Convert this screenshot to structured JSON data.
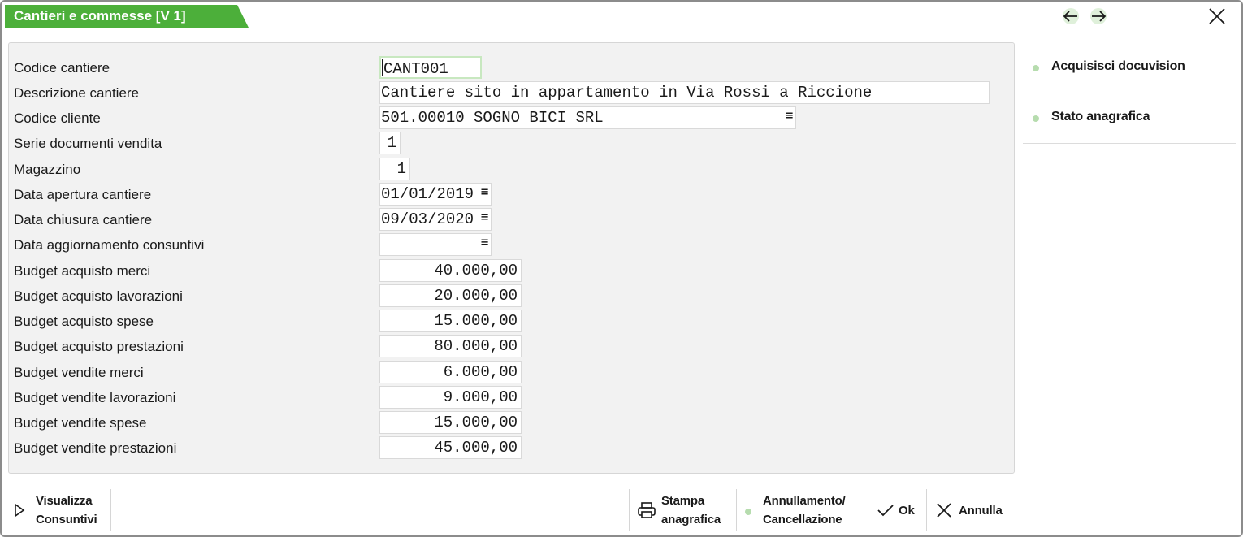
{
  "window": {
    "title": "Cantieri e commesse [V 1]",
    "accent_color": "#4caf3a",
    "icons": {
      "back": "arrow-left-icon",
      "forward": "arrow-right-icon",
      "close": "close-icon"
    }
  },
  "form": {
    "fields": [
      {
        "key": "codice_cantiere",
        "label": "Codice cantiere",
        "value": "CANT001"
      },
      {
        "key": "descrizione_cantiere",
        "label": "Descrizione cantiere",
        "value": "Cantiere sito in appartamento in Via Rossi a Riccione"
      },
      {
        "key": "codice_cliente",
        "label": "Codice cliente",
        "value": "501.00010 SOGNO BICI SRL"
      },
      {
        "key": "serie_documenti",
        "label": "Serie documenti vendita",
        "value": "1"
      },
      {
        "key": "magazzino",
        "label": "Magazzino",
        "value": "1"
      },
      {
        "key": "data_apertura",
        "label": "Data apertura cantiere",
        "value": "01/01/2019"
      },
      {
        "key": "data_chiusura",
        "label": "Data chiusura cantiere",
        "value": "09/03/2020"
      },
      {
        "key": "data_aggiornamento",
        "label": "Data aggiornamento consuntivi",
        "value": ""
      },
      {
        "key": "budget_acq_merci",
        "label": "Budget acquisto merci",
        "value": "40.000,00"
      },
      {
        "key": "budget_acq_lavorazioni",
        "label": "Budget acquisto lavorazioni",
        "value": "20.000,00"
      },
      {
        "key": "budget_acq_spese",
        "label": "Budget acquisto spese",
        "value": "15.000,00"
      },
      {
        "key": "budget_acq_prestazioni",
        "label": "Budget acquisto prestazioni",
        "value": "80.000,00"
      },
      {
        "key": "budget_ven_merci",
        "label": "Budget vendite merci",
        "value": "6.000,00"
      },
      {
        "key": "budget_ven_lavorazioni",
        "label": "Budget vendite lavorazioni",
        "value": "9.000,00"
      },
      {
        "key": "budget_ven_spese",
        "label": "Budget vendite spese",
        "value": "15.000,00"
      },
      {
        "key": "budget_ven_prestazioni",
        "label": "Budget vendite prestazioni",
        "value": "45.000,00"
      }
    ],
    "lookup_glyph": "≡"
  },
  "side_menu": {
    "items": [
      {
        "label": "Acquisisci docuvision"
      },
      {
        "label": "Stato anagrafica"
      }
    ]
  },
  "bottom_bar": {
    "visualizza": {
      "line1": "Visualizza",
      "line2": "Consuntivi"
    },
    "stampa": {
      "line1": "Stampa",
      "line2": "anagrafica"
    },
    "annullamento": {
      "line1": "Annullamento/",
      "line2": "Cancellazione"
    },
    "ok": "Ok",
    "annulla": "Annulla"
  }
}
